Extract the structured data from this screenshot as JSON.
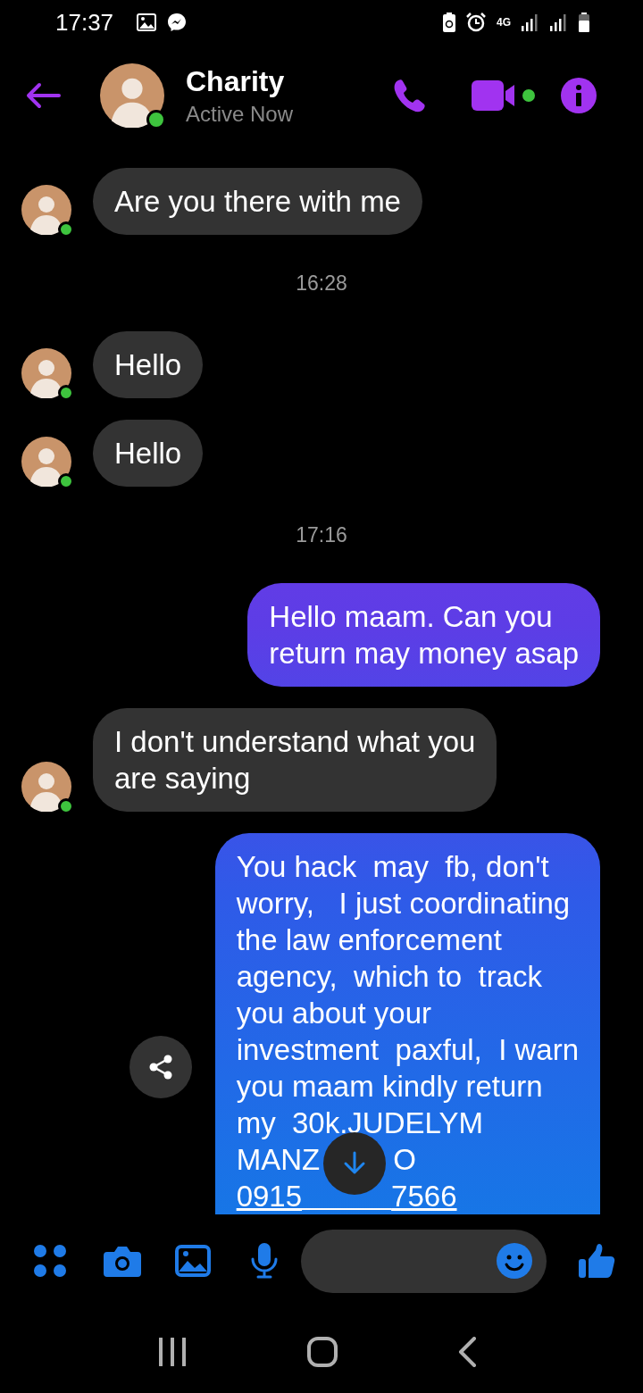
{
  "status_bar": {
    "time": "17:37",
    "network": "4G"
  },
  "contact": {
    "name": "Charity",
    "status": "Active Now",
    "online": true
  },
  "messages": [
    {
      "kind": "received",
      "text": "Are you there with me",
      "online": true
    },
    {
      "kind": "time",
      "text": "16:28"
    },
    {
      "kind": "received",
      "text": "Hello",
      "online": true
    },
    {
      "kind": "received",
      "text": "Hello",
      "online": true
    },
    {
      "kind": "time",
      "text": "17:16"
    },
    {
      "kind": "sent",
      "text": "Hello maam. Can you\nreturn may money asap"
    },
    {
      "kind": "received",
      "text": "I don't understand what you\nare saying",
      "online": true
    },
    {
      "kind": "sent",
      "text": "You hack  may  fb, don't\nworry,   I just coordinating\nthe law enforcement\nagency,  which to  track\nyou about your\ninvestment  paxful,  I warn\nyou maam kindly return\nmy  30k.JUDELYM",
      "tail": [
        "MANZ",
        "O"
      ],
      "link": [
        "0915",
        "7566"
      ],
      "share": true
    }
  ]
}
